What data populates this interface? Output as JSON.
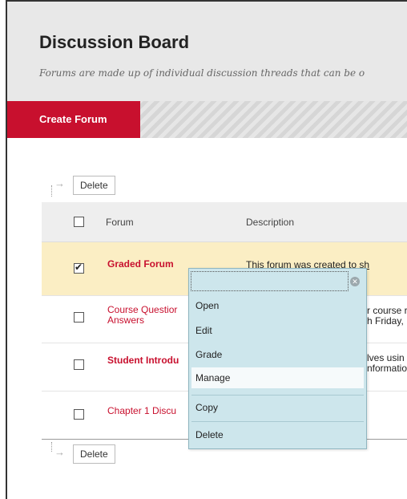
{
  "header": {
    "title": "Discussion Board",
    "subtitle": "Forums are made up of individual discussion threads that can be o"
  },
  "actionbar": {
    "create_forum": "Create Forum"
  },
  "delete_label": "Delete",
  "table": {
    "columns": [
      "Forum",
      "Description"
    ],
    "rows": [
      {
        "name_lines": [
          "Graded Forum"
        ],
        "description_lines": [
          "This forum was created to sh"
        ],
        "checked": true,
        "bold": true
      },
      {
        "name_lines": [
          "Course Questior",
          "Answers"
        ],
        "description_lines": [
          "r course r",
          "h Friday,"
        ],
        "checked": false,
        "bold": false
      },
      {
        "name_lines": [
          "Student Introdu"
        ],
        "description_lines": [
          "lves usin",
          "nformatio"
        ],
        "checked": false,
        "bold": true
      },
      {
        "name_lines": [
          "Chapter 1 Discu"
        ],
        "description_lines": [
          ""
        ],
        "checked": false,
        "bold": false
      }
    ]
  },
  "context_menu": {
    "items": [
      "Open",
      "Edit",
      "Grade",
      "Manage",
      "Copy",
      "Delete"
    ],
    "highlighted": "Manage",
    "close_icon": "close-circle-icon"
  },
  "colors": {
    "accent": "#c8102e",
    "selected_row": "#fbeec4",
    "menu_bg": "#cde6ec"
  }
}
